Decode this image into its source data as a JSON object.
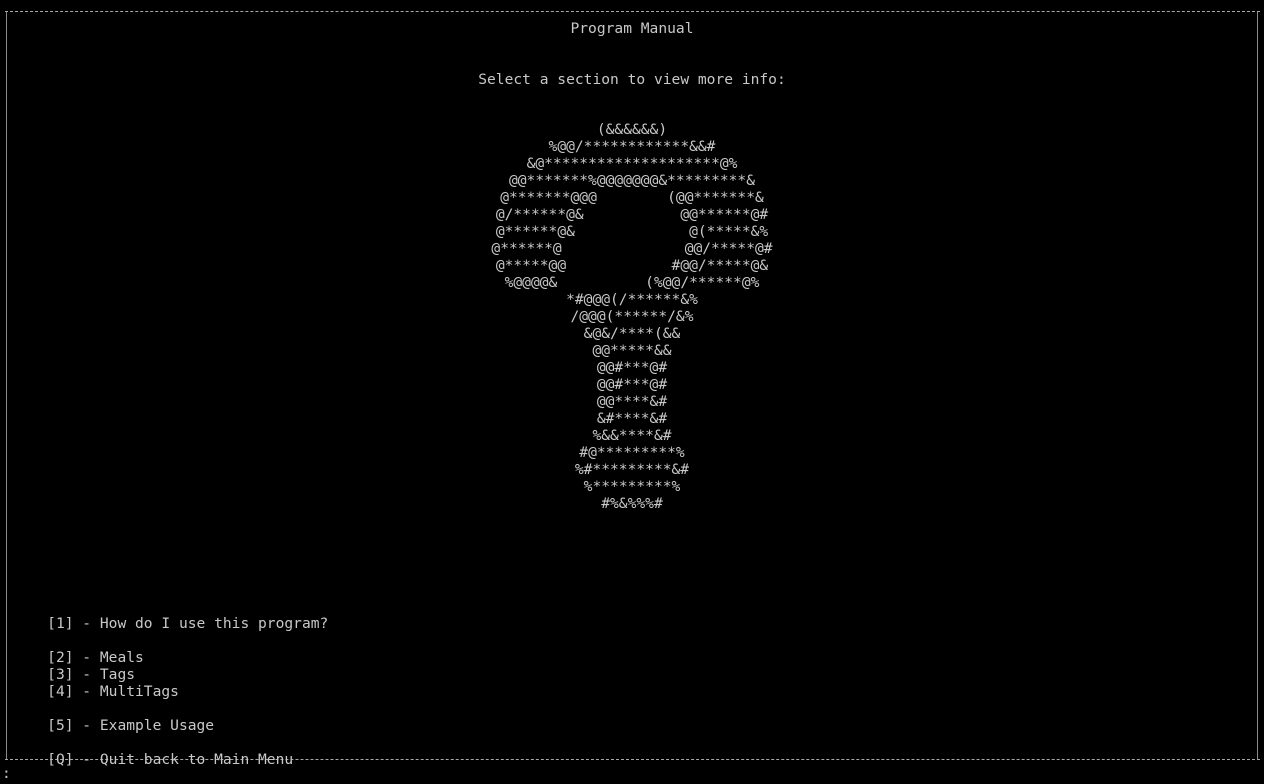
{
  "header": {
    "title": "Program Manual",
    "subtitle": "Select a section to view more info:"
  },
  "art": [
    "(&&&&&&)",
    "%@@/************&&#",
    "&@********************@%",
    "@@*******%@@@@@@@&*********&",
    "@*******@@@        (@@*******&",
    "@/******@&           @@******@#",
    "@******@&             @(*****&%",
    "@******@              @@/*****@#",
    "@*****@@            #@@/*****@&",
    "%@@@@&          (%@@/******@%",
    "*#@@@(/******&%",
    "/@@@(******/&%",
    "&@&/****(&&",
    "@@*****&&",
    "@@#***@#",
    "@@#***@#",
    "@@****&#",
    "&#****&#",
    "%&&****&#",
    "#@*********%",
    "%#*********&#",
    "%*********%",
    "#%&%%%#"
  ],
  "menu": [
    {
      "key": "[1]",
      "label": "How do I use this program?"
    },
    {
      "key": "[2]",
      "label": "Meals"
    },
    {
      "key": "[3]",
      "label": "Tags"
    },
    {
      "key": "[4]",
      "label": "MultiTags"
    },
    {
      "key": "[5]",
      "label": "Example Usage"
    },
    {
      "key": "[Q]",
      "label": "Quit back to Main Menu"
    }
  ],
  "prompt": ":"
}
